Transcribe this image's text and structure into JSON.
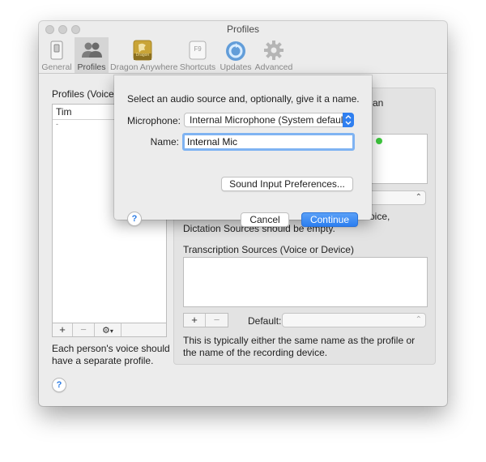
{
  "window": {
    "title": "Profiles"
  },
  "toolbar": {
    "items": [
      {
        "label": "General",
        "icon": "switch-icon"
      },
      {
        "label": "Profiles",
        "icon": "people-icon",
        "active": true
      },
      {
        "label": "Dragon Anywhere",
        "icon": "dragon-icon",
        "badge": "Dragon"
      },
      {
        "label": "Shortcuts",
        "icon": "keyboard-f9-icon",
        "key": "F9"
      },
      {
        "label": "Updates",
        "icon": "updates-icon"
      },
      {
        "label": "Advanced",
        "icon": "gear-icon"
      }
    ]
  },
  "profiles": {
    "section_label": "Profiles (Voices",
    "column_header": "Tim",
    "row_marker": "-",
    "add_label": "+",
    "remove_label": "−",
    "gear_label": "▾",
    "help_text": "Each person's voice should have a separate profile."
  },
  "right": {
    "partial_top": "an",
    "partial_mid_1": "oice,",
    "partial_mid_2": "Dictation Sources should be empty.",
    "transcription_label": "Transcription Sources (Voice or Device)",
    "add_label": "+",
    "remove_label": "−",
    "default_label": "Default:",
    "help_text": "This is typically either the same name as the profile or the name of the recording device."
  },
  "sheet": {
    "prompt": "Select an audio source and, optionally, give it a name.",
    "microphone_label": "Microphone:",
    "microphone_value": "Internal Microphone (System default)",
    "name_label": "Name:",
    "name_value": "Internal Mic",
    "sound_prefs_button": "Sound Input Preferences...",
    "cancel_button": "Cancel",
    "continue_button": "Continue",
    "help_symbol": "?"
  },
  "window_help_symbol": "?",
  "colors": {
    "accent": "#2b7ef0",
    "status_dot": "#3ec93e"
  }
}
